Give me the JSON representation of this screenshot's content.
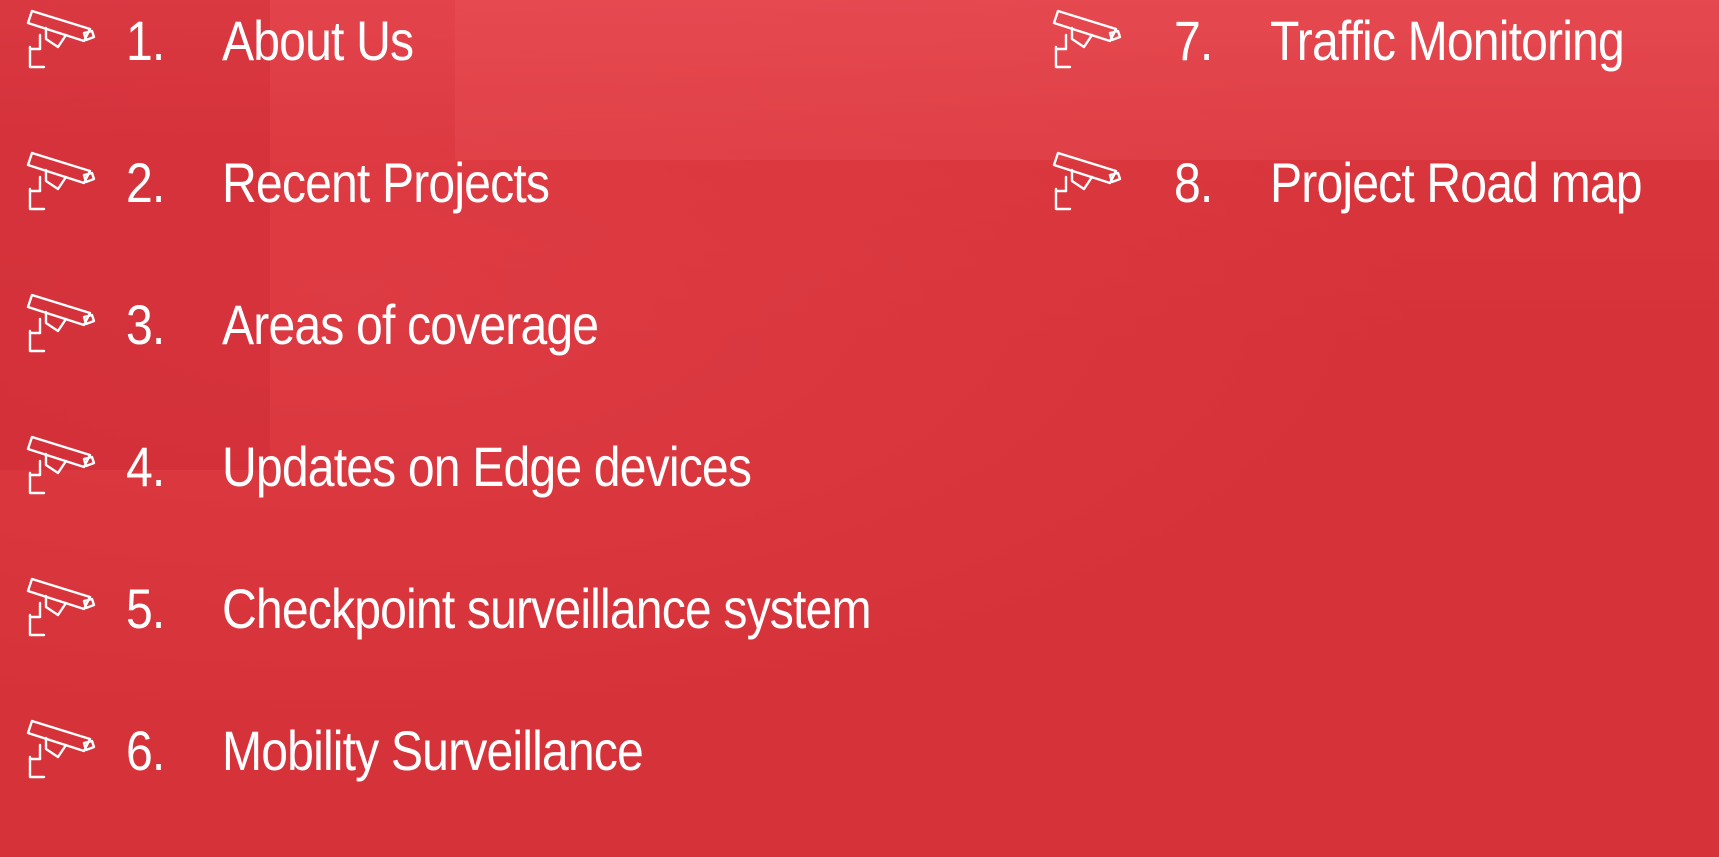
{
  "accent_color": "#d6323a",
  "text_color": "#ffffff",
  "item_icon": "cctv-camera-icon",
  "left_column": [
    {
      "number": "1.",
      "label": "About Us"
    },
    {
      "number": "2.",
      "label": "Recent Projects"
    },
    {
      "number": "3.",
      "label": "Areas of coverage"
    },
    {
      "number": "4.",
      "label": "Updates on Edge devices"
    },
    {
      "number": "5.",
      "label": "Checkpoint surveillance system"
    },
    {
      "number": "6.",
      "label": "Mobility Surveillance"
    }
  ],
  "right_column": [
    {
      "number": "7.",
      "label": "Traffic Monitoring"
    },
    {
      "number": "8.",
      "label": "Project Road map"
    }
  ]
}
